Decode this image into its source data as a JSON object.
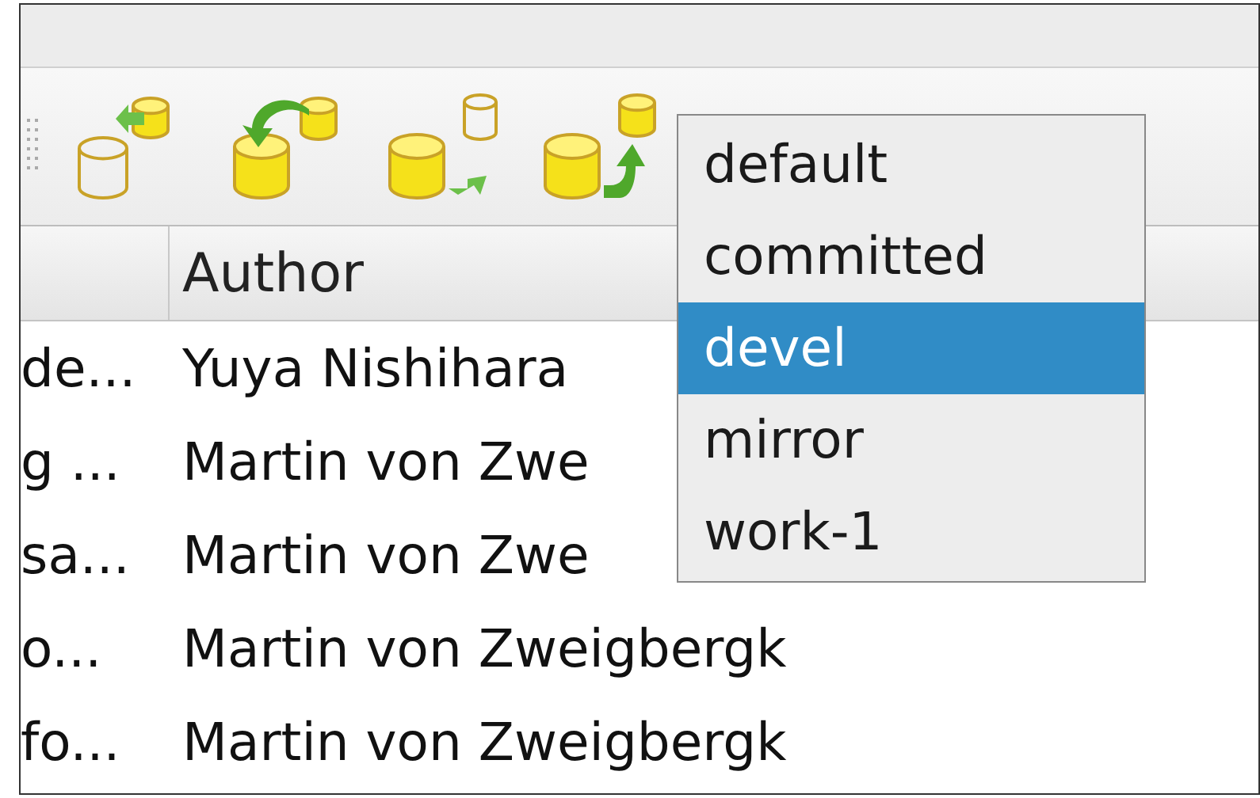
{
  "dropdown": {
    "items": [
      {
        "label": "default",
        "selected": false
      },
      {
        "label": "committed",
        "selected": false
      },
      {
        "label": "devel",
        "selected": true
      },
      {
        "label": "mirror",
        "selected": false
      },
      {
        "label": "work-1",
        "selected": false
      }
    ]
  },
  "table": {
    "author_header": "Author",
    "rows": [
      {
        "column_1": "de...",
        "author": "Yuya Nishihara"
      },
      {
        "column_1": "g ...",
        "author": "Martin von Zwe"
      },
      {
        "column_1": "sa...",
        "author": "Martin von Zwe"
      },
      {
        "column_1": "o...",
        "author": "Martin von Zweigbergk"
      },
      {
        "column_1": "fo...",
        "author": "Martin von Zweigbergk"
      }
    ]
  }
}
